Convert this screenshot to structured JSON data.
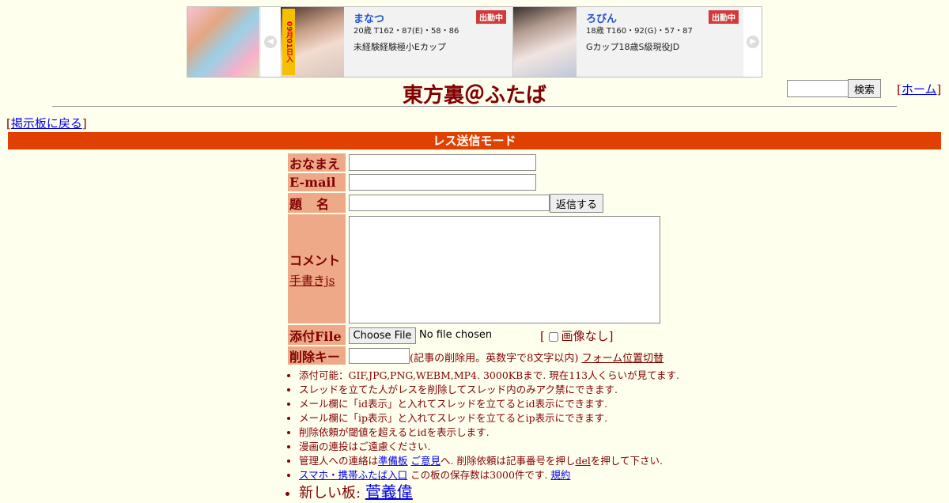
{
  "banner": {
    "cards": [
      {
        "name": "まなつ",
        "badge": "出勤中",
        "spec": "20歳 T162・87(E)・58・86",
        "desc": "未経験経験極小Eカップ",
        "tag": "09月01日入"
      },
      {
        "name": "ろびん",
        "badge": "出勤中",
        "spec": "18歳 T160・92(G)・57・87",
        "desc": "Gカップ18歳S級現役JD"
      }
    ]
  },
  "header": {
    "title": "東方裏＠ふたば",
    "search_button": "検索",
    "home_link": "ホーム",
    "back_link": "掲示板に戻る"
  },
  "mode_bar": "レス送信モード",
  "form": {
    "name_label": "おなまえ",
    "email_label": "E-mail",
    "subject_label": "題名",
    "reply_button": "返信する",
    "comment_label": "コメント",
    "handwrite_link": "手書きjs",
    "file_label": "添付File",
    "choose_file": "Choose File",
    "no_file": "No file chosen",
    "no_image": "画像なし",
    "del_label": "削除キー",
    "del_note": "(記事の削除用。英数字で8文字以内)",
    "form_switch": "フォーム位置切替"
  },
  "notes": {
    "n1": "添付可能：GIF,JPG,PNG,WEBM,MP4. 3000KBまで. 現在113人くらいが見てます.",
    "n2": "スレッドを立てた人がレスを削除してスレッド内のみアク禁にできます.",
    "n3": "メール欄に「id表示」と入れてスレッドを立てるとid表示にできます.",
    "n4": "メール欄に「ip表示」と入れてスレッドを立てるとip表示にできます.",
    "n5": "削除依頼が閾値を超えるとidを表示します.",
    "n6": "漫画の連投はご遠慮ください.",
    "n7_pre": "管理人への連絡は",
    "n7_link1": "準備板",
    "n7_link2": "ご意見",
    "n7_mid": "へ. 削除依頼は記事番号を押し",
    "n7_link3": "del",
    "n7_post": "を押して下さい.",
    "n8_link": "スマホ・携帯ふたば入口",
    "n8_mid": "この板の保存数は3000件です.",
    "n8_link2": "規約",
    "n9_pre": "新しい板:",
    "n9_link": "菅義偉"
  }
}
